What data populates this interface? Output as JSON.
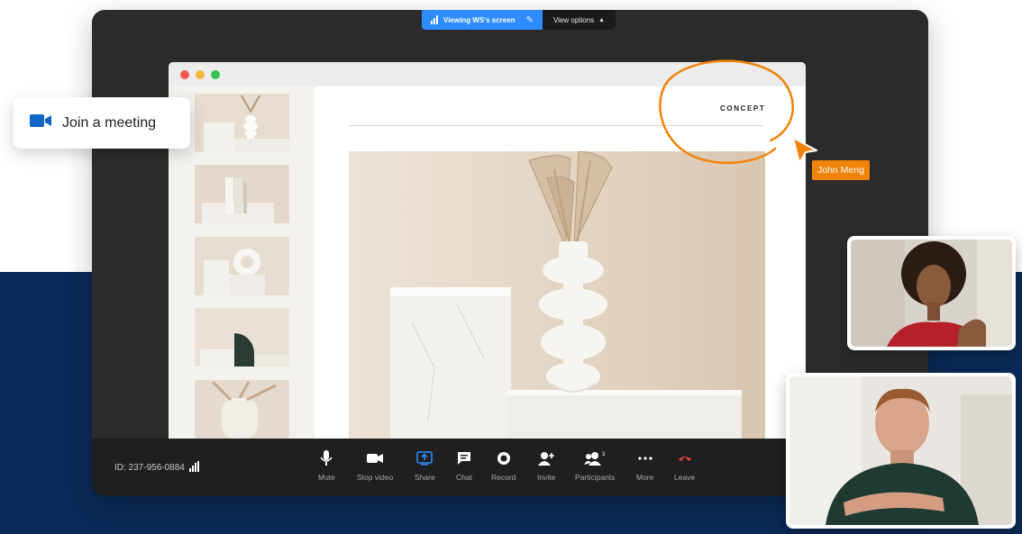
{
  "share_bar": {
    "viewing_label": "Viewing WS's screen",
    "view_options_label": "View options"
  },
  "join_card": {
    "label": "Join a meeting",
    "icon": "video-camera-icon",
    "accent": "#1264c8"
  },
  "document": {
    "heading": "CONCEPT"
  },
  "annotation": {
    "presenter_name": "John Meng",
    "color": "#f0830a"
  },
  "toolbar": {
    "meeting_id": "ID: 237-956-0884",
    "items": [
      {
        "label": "Mute",
        "icon": "microphone-icon"
      },
      {
        "label": "Stop video",
        "icon": "video-camera-icon"
      },
      {
        "label": "Share",
        "icon": "share-screen-icon"
      },
      {
        "label": "Chat",
        "icon": "chat-icon"
      },
      {
        "label": "Record",
        "icon": "record-icon"
      },
      {
        "label": "Invite",
        "icon": "invite-icon"
      },
      {
        "label": "Participants",
        "icon": "participants-icon",
        "count": "3"
      },
      {
        "label": "More",
        "icon": "more-icon"
      },
      {
        "label": "Leave",
        "icon": "leave-call-icon"
      }
    ]
  },
  "colors": {
    "navy": "#0c2a57",
    "window": "#2b2b2b",
    "toolbar": "#1f1f1f",
    "zoom_blue": "#2d8cff",
    "leave_red": "#e0433c"
  }
}
